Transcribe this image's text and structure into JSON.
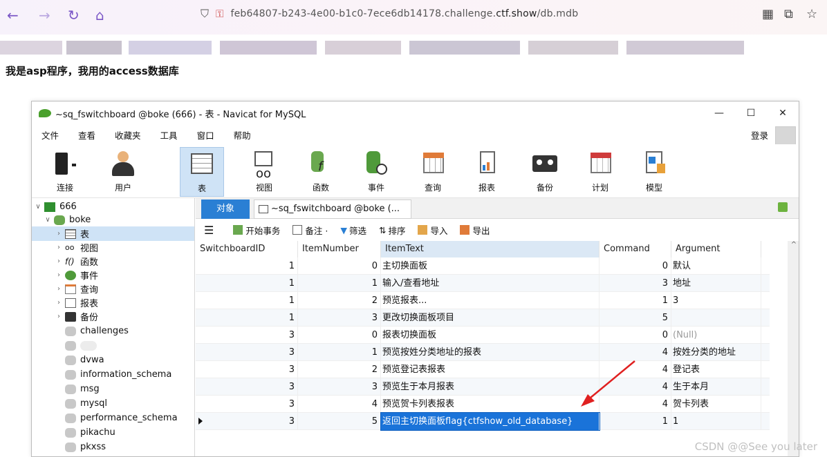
{
  "browser": {
    "url_prefix": "feb64807-b243-4e00-b1c0-7ece6db14178.challenge.",
    "url_domain": "ctf.show",
    "url_path": "/db.mdb"
  },
  "intro_text": "我是asp程序，我用的access数据库",
  "window": {
    "title": "~sq_fswitchboard @boke (666) - 表 - Navicat for MySQL",
    "minimize": "—",
    "maximize": "☐",
    "close": "✕"
  },
  "menu": [
    "文件",
    "查看",
    "收藏夹",
    "工具",
    "窗口",
    "帮助"
  ],
  "login_label": "登录",
  "toolbar": [
    "连接",
    "用户",
    "表",
    "视图",
    "函数",
    "事件",
    "查询",
    "报表",
    "备份",
    "计划",
    "模型"
  ],
  "sidebar": {
    "connection": "666",
    "database": "boke",
    "children": [
      "表",
      "视图",
      "函数",
      "事件",
      "查询",
      "报表",
      "备份"
    ],
    "databases": [
      "challenges",
      "",
      "dvwa",
      "information_schema",
      "msg",
      "mysql",
      "performance_schema",
      "pikachu",
      "pkxss"
    ]
  },
  "tabs": {
    "objects": "对象",
    "table_tab": "~sq_fswitchboard @boke (..."
  },
  "subtoolbar": [
    "开始事务",
    "备注 ·",
    "筛选",
    "排序",
    "导入",
    "导出"
  ],
  "columns": [
    "SwitchboardID",
    "ItemNumber",
    "ItemText",
    "Command",
    "Argument"
  ],
  "rows": [
    [
      "1",
      "0",
      "主切换面板",
      "0",
      "默认"
    ],
    [
      "1",
      "1",
      "输入/查看地址",
      "3",
      "地址"
    ],
    [
      "1",
      "2",
      "预览报表...",
      "1",
      "3"
    ],
    [
      "1",
      "3",
      "更改切换面板项目",
      "5",
      ""
    ],
    [
      "3",
      "0",
      "报表切换面板",
      "0",
      "(Null)"
    ],
    [
      "3",
      "1",
      "预览按姓分类地址的报表",
      "4",
      "按姓分类的地址"
    ],
    [
      "3",
      "2",
      "预览登记表报表",
      "4",
      "登记表"
    ],
    [
      "3",
      "3",
      "预览生于本月报表",
      "4",
      "生于本月"
    ],
    [
      "3",
      "4",
      "预览贺卡列表报表",
      "4",
      "贺卡列表"
    ],
    [
      "3",
      "5",
      "返回主切换面板flag{ctfshow_old_database}",
      "1",
      "1"
    ]
  ],
  "watermark": "CSDN @@See  you  later"
}
